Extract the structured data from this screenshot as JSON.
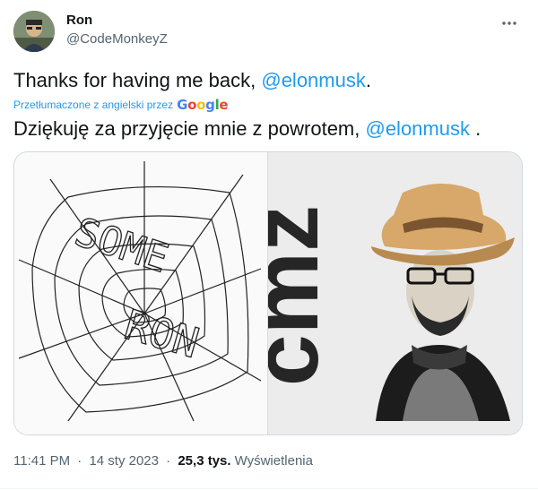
{
  "author": {
    "display_name": "Ron",
    "handle": "@CodeMonkeyZ"
  },
  "tweet": {
    "text_prefix": "Thanks for having me back, ",
    "mention": "@elonmusk",
    "text_suffix": ".",
    "translated_by_label": "Przetłumaczone z angielski przez",
    "translator_logo": "Google",
    "translation_prefix": "Dziękuję za przyjęcie mnie z powrotem, ",
    "translation_mention": "@elonmusk",
    "translation_suffix": " ."
  },
  "media": {
    "left_image_text_line1": "SOME",
    "left_image_text_line2": "RON",
    "right_image_text": "cmz"
  },
  "meta": {
    "time": "11:41 PM",
    "separator": "·",
    "date": "14 sty 2023",
    "views_count": "25,3 tys.",
    "views_label": "Wyświetlenia"
  },
  "colors": {
    "accent": "#1d9bf0",
    "text": "#0f1419",
    "secondary": "#536471"
  },
  "icons": [
    "more-options-icon",
    "avatar",
    "google-logo"
  ]
}
